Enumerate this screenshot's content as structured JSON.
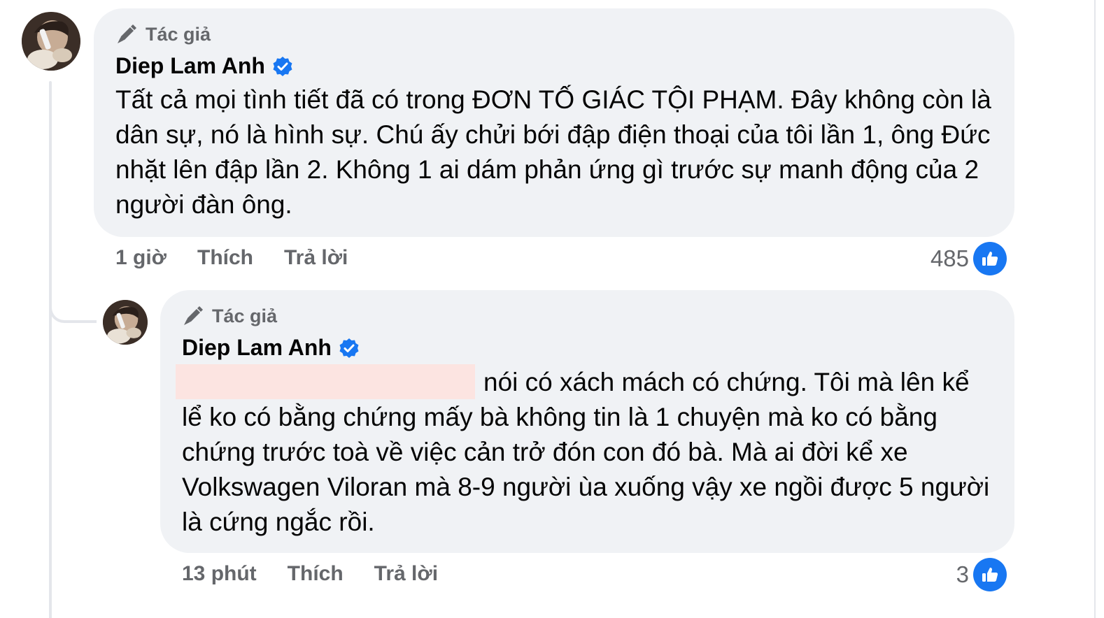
{
  "colors": {
    "bubble_bg": "#f0f2f5",
    "secondary_text": "#65676b",
    "like_blue": "#1877f2",
    "redaction": "#fce4e1"
  },
  "comments": [
    {
      "author_tag": "Tác giả",
      "author_name": "Diep Lam Anh",
      "verified_icon": "verified-badge-icon",
      "text": "Tất cả mọi tình tiết đã có trong ĐƠN TỐ GIÁC TỘI PHẠM. Đây không còn là dân sự, nó là hình sự. Chú ấy chửi bới đập điện thoại của tôi lần 1, ông Đức nhặt lên đập lần 2. Không 1 ai dám phản ứng gì trước sự manh động của 2 người đàn ông.",
      "time": "1 giờ",
      "like_label": "Thích",
      "reply_label": "Trả lời",
      "reaction_count": "485"
    },
    {
      "author_tag": "Tác giả",
      "author_name": "Diep Lam Anh",
      "verified_icon": "verified-badge-icon",
      "text": "nói có xách mách có chứng. Tôi mà lên kể lể ko có bằng chứng mấy bà không tin là 1 chuyện mà ko có bằng chứng trước toà về việc cản trở đón con đó bà. Mà ai đời kể xe Volkswagen Viloran mà 8-9 người ùa xuống vậy xe ngồi được 5 người là cứng ngắc rồi.",
      "time": "13 phút",
      "like_label": "Thích",
      "reply_label": "Trả lời",
      "reaction_count": "3"
    }
  ]
}
